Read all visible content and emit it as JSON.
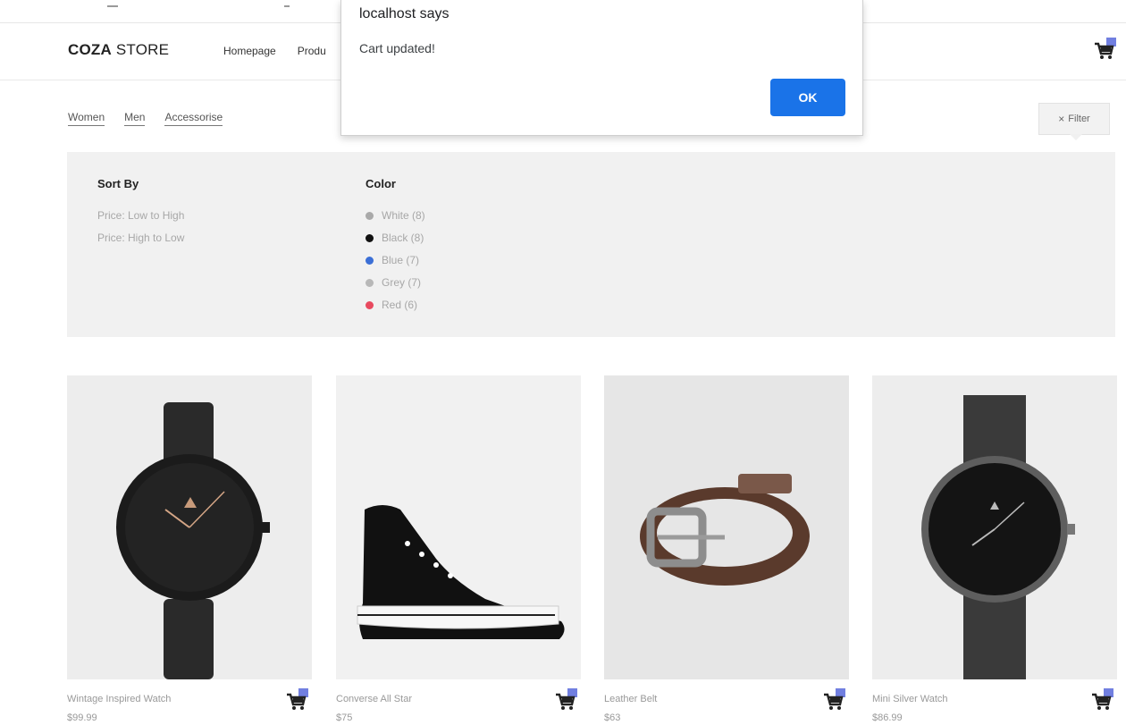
{
  "header": {
    "logo_bold": "COZA",
    "logo_rest": " STORE",
    "nav": [
      "Homepage",
      "Produ"
    ]
  },
  "categories": [
    "Women",
    "Men",
    "Accessorise"
  ],
  "filter_button": {
    "icon": "close-icon",
    "label": "Filter"
  },
  "filter_panel": {
    "sort": {
      "title": "Sort By",
      "options": [
        "Price: Low to High",
        "Price: High to Low"
      ]
    },
    "color": {
      "title": "Color",
      "options": [
        {
          "label": "White (8)",
          "color": "#a9a9a9"
        },
        {
          "label": "Black (8)",
          "color": "#111111"
        },
        {
          "label": "Blue (7)",
          "color": "#3b6fd6"
        },
        {
          "label": "Grey (7)",
          "color": "#b8b8b8"
        },
        {
          "label": "Red (6)",
          "color": "#e84a5f"
        }
      ]
    }
  },
  "dialog": {
    "title": "localhost says",
    "message": "Cart updated!",
    "ok_label": "OK"
  },
  "products": [
    {
      "name": "Wintage Inspired Watch",
      "price": "$99.99",
      "image": "black-watch"
    },
    {
      "name": "Converse All Star",
      "price": "$75",
      "image": "sneaker"
    },
    {
      "name": "Leather Belt",
      "price": "$63",
      "image": "belt"
    },
    {
      "name": "Mini Silver Watch",
      "price": "$86.99",
      "image": "mesh-watch"
    }
  ],
  "colors": {
    "accent": "#717fe0",
    "dialog_button": "#1a73e8"
  }
}
